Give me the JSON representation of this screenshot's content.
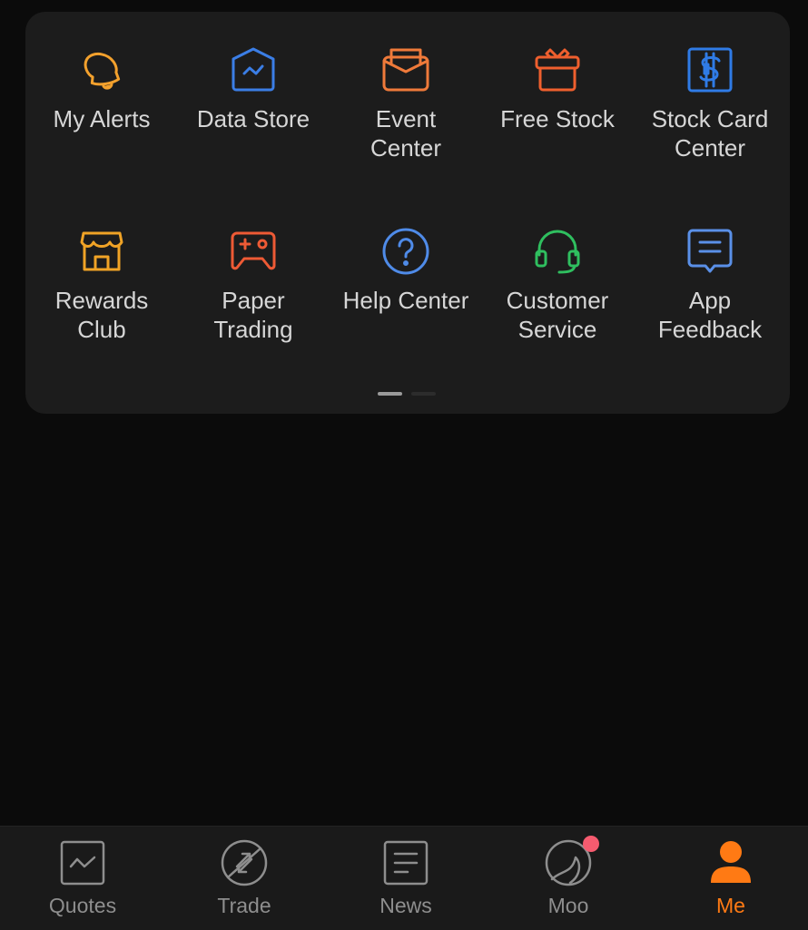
{
  "grid": {
    "row1": [
      {
        "label": "My Alerts",
        "icon": "bell-icon",
        "color": "#f3a12d"
      },
      {
        "label": "Data Store",
        "icon": "data-store-icon",
        "color": "#3b7ee6"
      },
      {
        "label": "Event\nCenter",
        "icon": "envelope-icon",
        "color": "#ef7a3a"
      },
      {
        "label": "Free Stock",
        "icon": "gift-icon",
        "color": "#ef5f2e"
      },
      {
        "label": "Stock Card\nCenter",
        "icon": "stock-card-icon",
        "color": "#2f7be6"
      }
    ],
    "row2": [
      {
        "label": "Rewards\nClub",
        "icon": "store-icon",
        "color": "#f0a326"
      },
      {
        "label": "Paper\nTrading",
        "icon": "gamepad-icon",
        "color": "#ee5a35"
      },
      {
        "label": "Help Center",
        "icon": "help-icon",
        "color": "#4f8be8"
      },
      {
        "label": "Customer\nService",
        "icon": "headset-icon",
        "color": "#2fbf5f"
      },
      {
        "label": "App\nFeedback",
        "icon": "feedback-icon",
        "color": "#5a90e8"
      }
    ]
  },
  "pager": {
    "pages": 2,
    "current": 1
  },
  "tabbar": {
    "tabs": [
      {
        "label": "Quotes",
        "icon": "quotes-icon",
        "active": false
      },
      {
        "label": "Trade",
        "icon": "trade-icon",
        "active": false
      },
      {
        "label": "News",
        "icon": "news-icon",
        "active": false
      },
      {
        "label": "Moo",
        "icon": "moo-icon",
        "active": false,
        "badge": true
      },
      {
        "label": "Me",
        "icon": "person-icon",
        "active": true
      }
    ],
    "inactive_color": "#8e8e8e",
    "active_color": "#ff7a14",
    "badge_color": "#f65b6f"
  }
}
